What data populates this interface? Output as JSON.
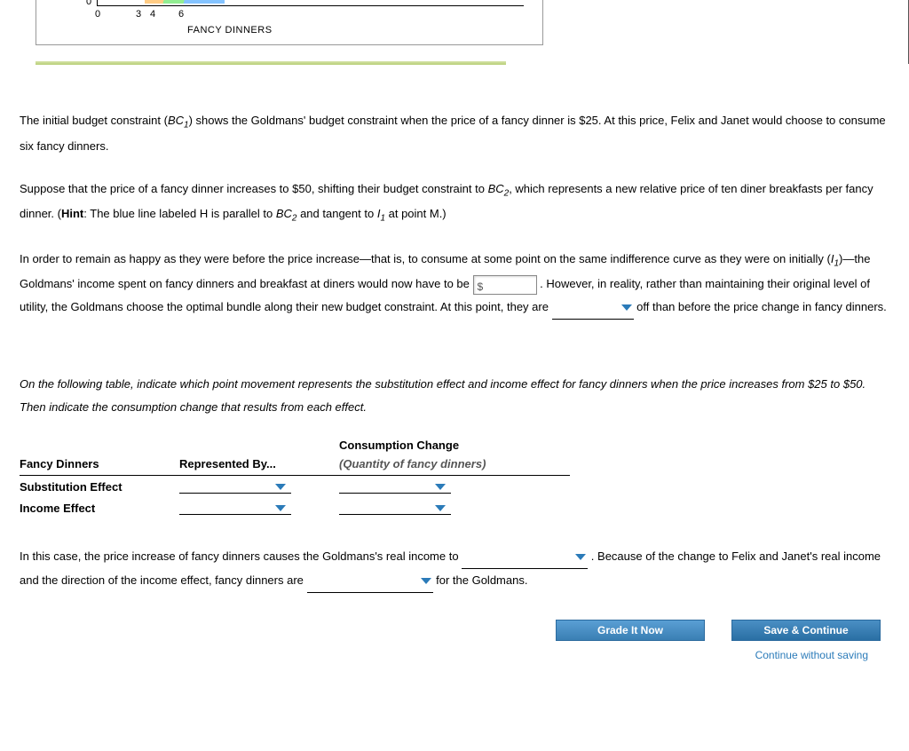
{
  "chart": {
    "y_zero": "0",
    "ticks": {
      "t0": "0",
      "t3": "3",
      "t4": "4",
      "t6": "6"
    },
    "xlabel": "FANCY DINNERS"
  },
  "para1": {
    "a": "The initial budget constraint (",
    "bc1": "BC",
    "bc1_sub": "1",
    "b": ") shows the Goldmans' budget constraint when the price of a fancy dinner is $25. At this price, Felix and Janet would choose to consume six fancy dinners."
  },
  "para2": {
    "a": "Suppose that the price of a fancy dinner increases to $50, shifting their budget constraint to ",
    "bc2": "BC",
    "bc2_sub": "2",
    "b": ", which represents a new relative price of ten diner breakfasts per fancy dinner. (",
    "hint_label": "Hint",
    "hint_rest": ": The blue line labeled H is parallel to ",
    "bc2b": "BC",
    "bc2b_sub": "2",
    "c": " and tangent to ",
    "i1": "I",
    "i1_sub": "1",
    "d": " at point M.)"
  },
  "para3": {
    "a": "In order to remain as happy as they were before the price increase—that is, to consume at some point on the same indifference curve as they were on initially (",
    "i1": "I",
    "i1_sub": "1",
    "b": ")—the Goldmans' income spent on fancy dinners and breakfast at diners would now have to be ",
    "input_prefix": "$",
    "c": " . However, in reality, rather than maintaining their original level of utility, the Goldmans choose the optimal bundle along their new budget constraint. At this point, they are ",
    "d": " off than before the price change in fancy dinners."
  },
  "para4": "On the following table, indicate which point movement represents the substitution effect and income effect for fancy dinners when the price increases from $25 to $50. Then indicate the consumption change that results from each effect.",
  "table": {
    "super_header": "Consumption Change",
    "h1": "Fancy Dinners",
    "h2": "Represented By...",
    "h3": "(Quantity of fancy dinners)",
    "r1": "Substitution Effect",
    "r2": "Income Effect"
  },
  "para5": {
    "a": "In this case, the price increase of fancy dinners causes the Goldmans's real income to ",
    "b": " . Because of the change to Felix and Janet's real income and the direction of the income effect, fancy dinners are ",
    "c": " for the Goldmans."
  },
  "buttons": {
    "grade": "Grade It Now",
    "save": "Save & Continue",
    "skip": "Continue without saving"
  }
}
